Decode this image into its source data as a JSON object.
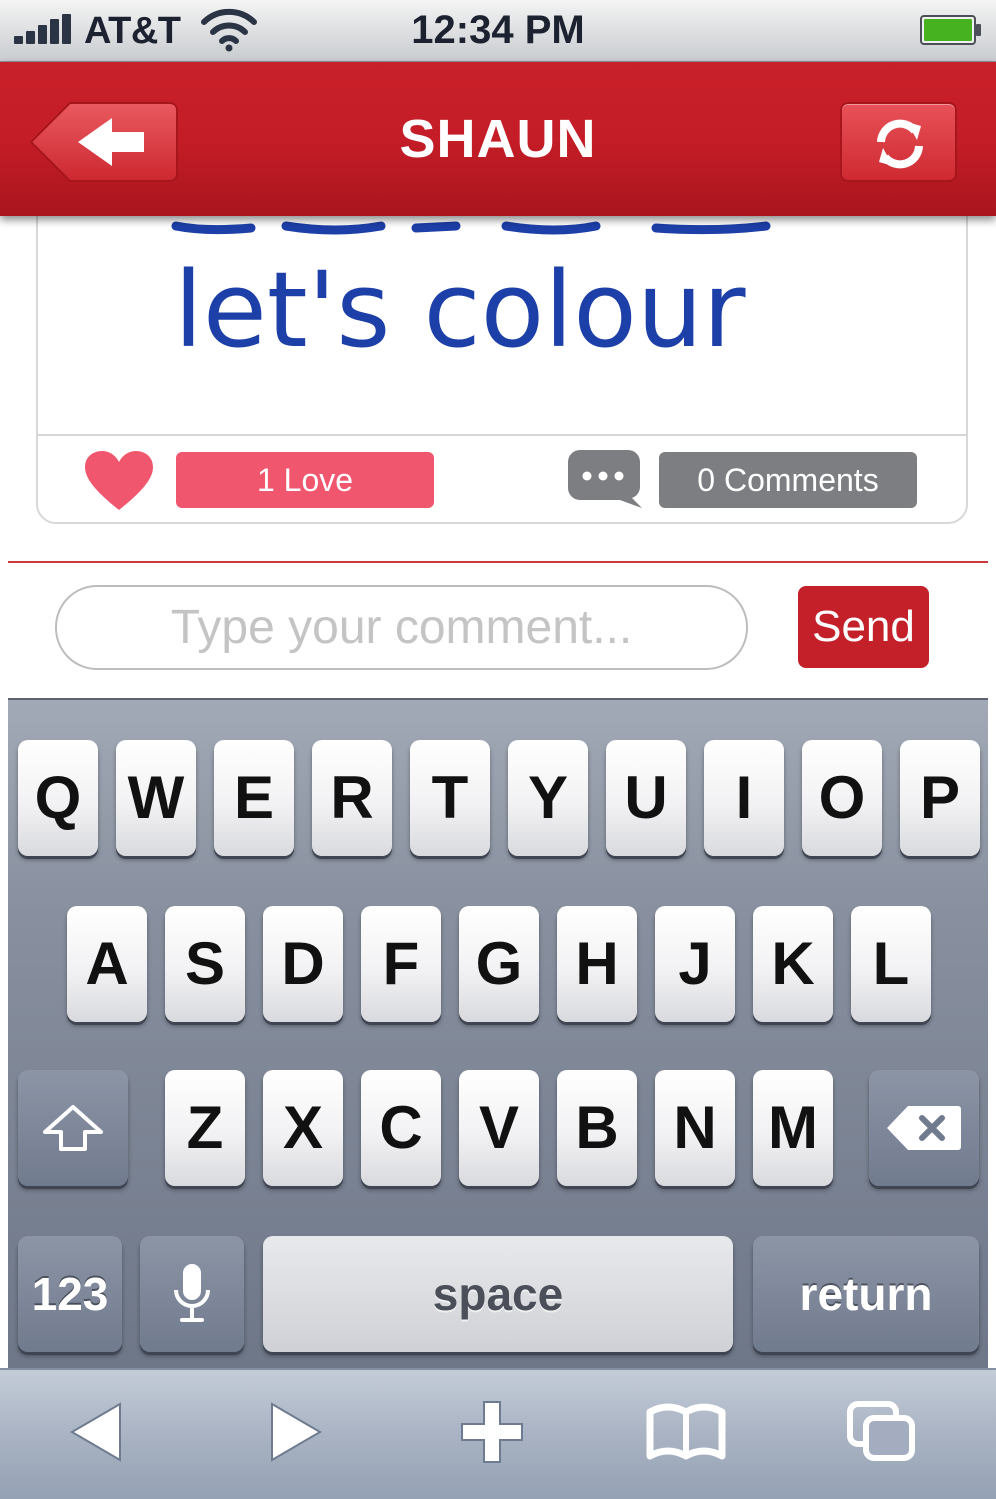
{
  "status_bar": {
    "carrier": "AT&T",
    "time": "12:34 PM"
  },
  "nav": {
    "title": "SHAUN"
  },
  "post": {
    "drawing_text": "let's colour",
    "love_label": "1 Love",
    "comments_label": "0 Comments"
  },
  "comment_box": {
    "placeholder": "Type your comment...",
    "value": "",
    "send_label": "Send"
  },
  "keyboard": {
    "row1": [
      "Q",
      "W",
      "E",
      "R",
      "T",
      "Y",
      "U",
      "I",
      "O",
      "P"
    ],
    "row2": [
      "A",
      "S",
      "D",
      "F",
      "G",
      "H",
      "J",
      "K",
      "L"
    ],
    "row3": [
      "Z",
      "X",
      "C",
      "V",
      "B",
      "N",
      "M"
    ],
    "numbers_label": "123",
    "space_label": "space",
    "return_label": "return"
  },
  "colors": {
    "brand_red": "#c4202a",
    "love_pink": "#f0576f",
    "comments_gray": "#7d7e82",
    "drawing_blue": "#1d3fa8"
  },
  "icons": {
    "back": "back-arrow-icon",
    "refresh": "refresh-icon",
    "love": "heart-icon",
    "comment": "speech-bubble-icon",
    "shift": "shift-arrow-icon",
    "delete": "backspace-icon",
    "mic": "microphone-icon",
    "toolbar": [
      "back-triangle-icon",
      "forward-triangle-icon",
      "plus-icon",
      "bookmarks-book-icon",
      "tabs-pages-icon"
    ]
  }
}
